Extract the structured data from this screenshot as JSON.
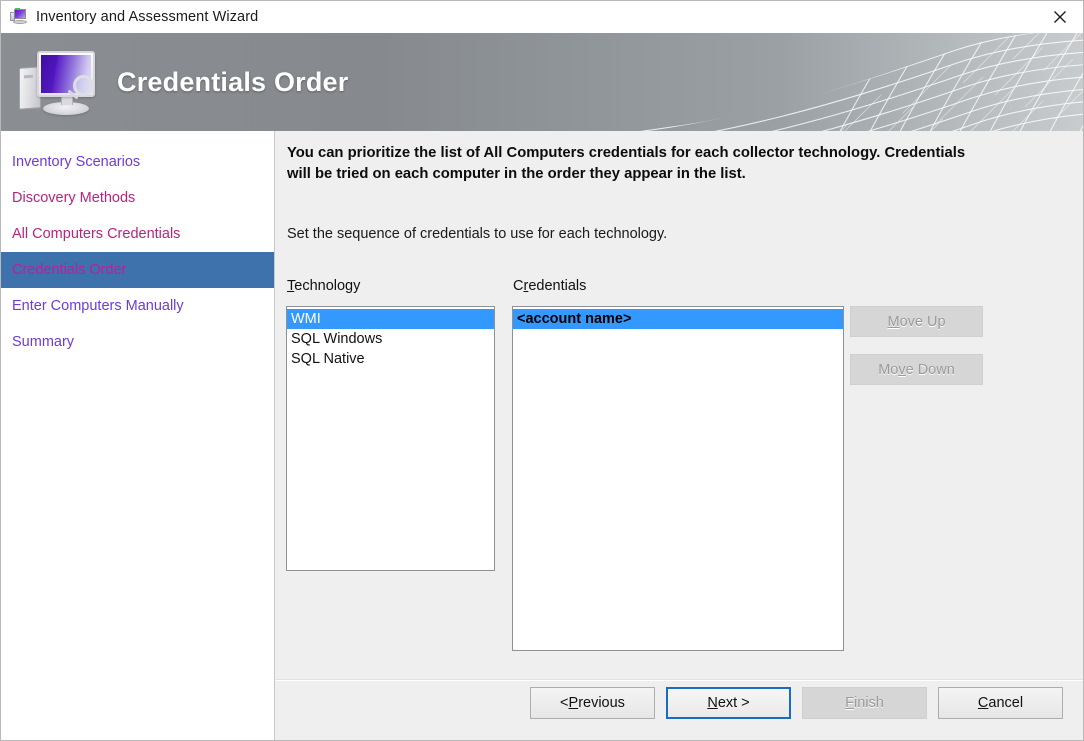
{
  "window": {
    "title": "Inventory and Assessment Wizard",
    "icon": "wizard-computer-icon",
    "close_label": "✕"
  },
  "banner": {
    "title": "Credentials Order",
    "icon": "computer-magnifier-icon",
    "background_color": "#8a8e92",
    "title_color": "#ffffff"
  },
  "sidebar": {
    "selected_index": 3,
    "selected_bg": "#3d72ad",
    "items": [
      {
        "label": "Inventory Scenarios",
        "color": "#6d3bd6"
      },
      {
        "label": "Discovery Methods",
        "color": "#b8237f"
      },
      {
        "label": "All Computers Credentials",
        "color": "#b8237f"
      },
      {
        "label": "Credentials Order",
        "color": "#c41a9b"
      },
      {
        "label": "Enter Computers Manually",
        "color": "#6d3bd6"
      },
      {
        "label": "Summary",
        "color": "#6d3bd6"
      }
    ]
  },
  "content": {
    "intro_bold": "You can prioritize the list of All Computers credentials for each collector technology. Credentials will be tried on each computer in the order they appear in the list.",
    "intro_plain": "Set the sequence of credentials to use for each technology.",
    "technology": {
      "label_pre": "",
      "label_mnemonic": "T",
      "label_post": "echnology",
      "items": [
        {
          "label": "WMI",
          "selected": true
        },
        {
          "label": "SQL Windows",
          "selected": false
        },
        {
          "label": "SQL Native",
          "selected": false
        }
      ]
    },
    "credentials": {
      "label_pre": "C",
      "label_mnemonic": "r",
      "label_post": "edentials",
      "items": [
        {
          "label": "<account name>",
          "selected": true
        }
      ]
    },
    "move_up": {
      "pre": "",
      "mnemonic": "M",
      "post": "ove Up",
      "disabled": true
    },
    "move_down": {
      "pre": "Mo",
      "mnemonic": "v",
      "post": "e Down",
      "disabled": true
    }
  },
  "footer": {
    "previous": {
      "pre": "< ",
      "mnemonic": "P",
      "post": "revious",
      "disabled": false,
      "default": false
    },
    "next": {
      "pre": "",
      "mnemonic": "N",
      "post": "ext >",
      "disabled": false,
      "default": true
    },
    "finish": {
      "pre": "",
      "mnemonic": "F",
      "post": "inish",
      "disabled": true,
      "default": false
    },
    "cancel": {
      "pre": "",
      "mnemonic": "C",
      "post": "ancel",
      "disabled": false,
      "default": false
    }
  }
}
